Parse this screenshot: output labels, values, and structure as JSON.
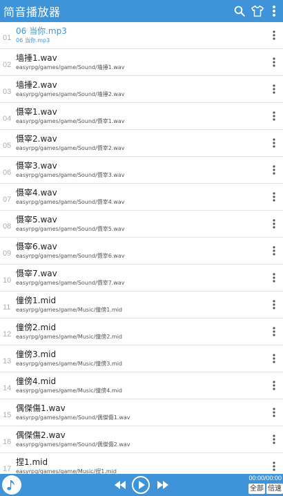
{
  "app": {
    "title": "简音播放器"
  },
  "icons": {
    "search": "search-icon",
    "theme": "tshirt-icon",
    "menu": "more-vert-icon",
    "note": "music-note-icon"
  },
  "colors": {
    "primary": "#3f94d9",
    "active_text": "#3f94d9"
  },
  "tracks": [
    {
      "num": "01",
      "name": "06 当你.mp3",
      "path": "06 当你.mp3",
      "active": true
    },
    {
      "num": "02",
      "name": "墙捶1.wav",
      "path": "easyrpg/games/game/Sound/墙捶1.wav"
    },
    {
      "num": "03",
      "name": "墙捶2.wav",
      "path": "easyrpg/games/game/Sound/墙捶2.wav"
    },
    {
      "num": "04",
      "name": "慑宰1.wav",
      "path": "easyrpg/games/game/Sound/慑宰1.wav"
    },
    {
      "num": "05",
      "name": "慑宰2.wav",
      "path": "easyrpg/games/game/Sound/慑宰2.wav"
    },
    {
      "num": "06",
      "name": "慑宰3.wav",
      "path": "easyrpg/games/game/Sound/慑宰3.wav"
    },
    {
      "num": "07",
      "name": "慑宰4.wav",
      "path": "easyrpg/games/game/Sound/慑宰4.wav"
    },
    {
      "num": "08",
      "name": "慑宰5.wav",
      "path": "easyrpg/games/game/Sound/慑宰5.wav"
    },
    {
      "num": "09",
      "name": "慑宰6.wav",
      "path": "easyrpg/games/game/Sound/慑宰6.wav"
    },
    {
      "num": "10",
      "name": "慑宰7.wav",
      "path": "easyrpg/games/game/Sound/慑宰7.wav"
    },
    {
      "num": "11",
      "name": "僮傍1.mid",
      "path": "easyrpg/games/game/Music/僮傍1.mid"
    },
    {
      "num": "12",
      "name": "僮傍2.mid",
      "path": "easyrpg/games/game/Music/僮傍2.mid"
    },
    {
      "num": "13",
      "name": "僮傍3.mid",
      "path": "easyrpg/games/game/Music/僮傍3.mid"
    },
    {
      "num": "14",
      "name": "僮傍4.mid",
      "path": "easyrpg/games/game/Music/僮傍4.mid"
    },
    {
      "num": "15",
      "name": "偶傑傷1.wav",
      "path": "easyrpg/games/game/Sound/偶傑傷1.wav"
    },
    {
      "num": "16",
      "name": "偶傑傷2.wav",
      "path": "easyrpg/games/game/Sound/偶傑傷2.wav"
    },
    {
      "num": "17",
      "name": "捏1.mid",
      "path": "easyrpg/games/game/Music/捏1.mid"
    }
  ],
  "player": {
    "time": "00:00/00:00",
    "mode_label": "全部",
    "speed_label": "倍速",
    "controls": {
      "prev": "skip-previous-icon",
      "play": "play-icon",
      "next": "skip-next-icon"
    }
  }
}
